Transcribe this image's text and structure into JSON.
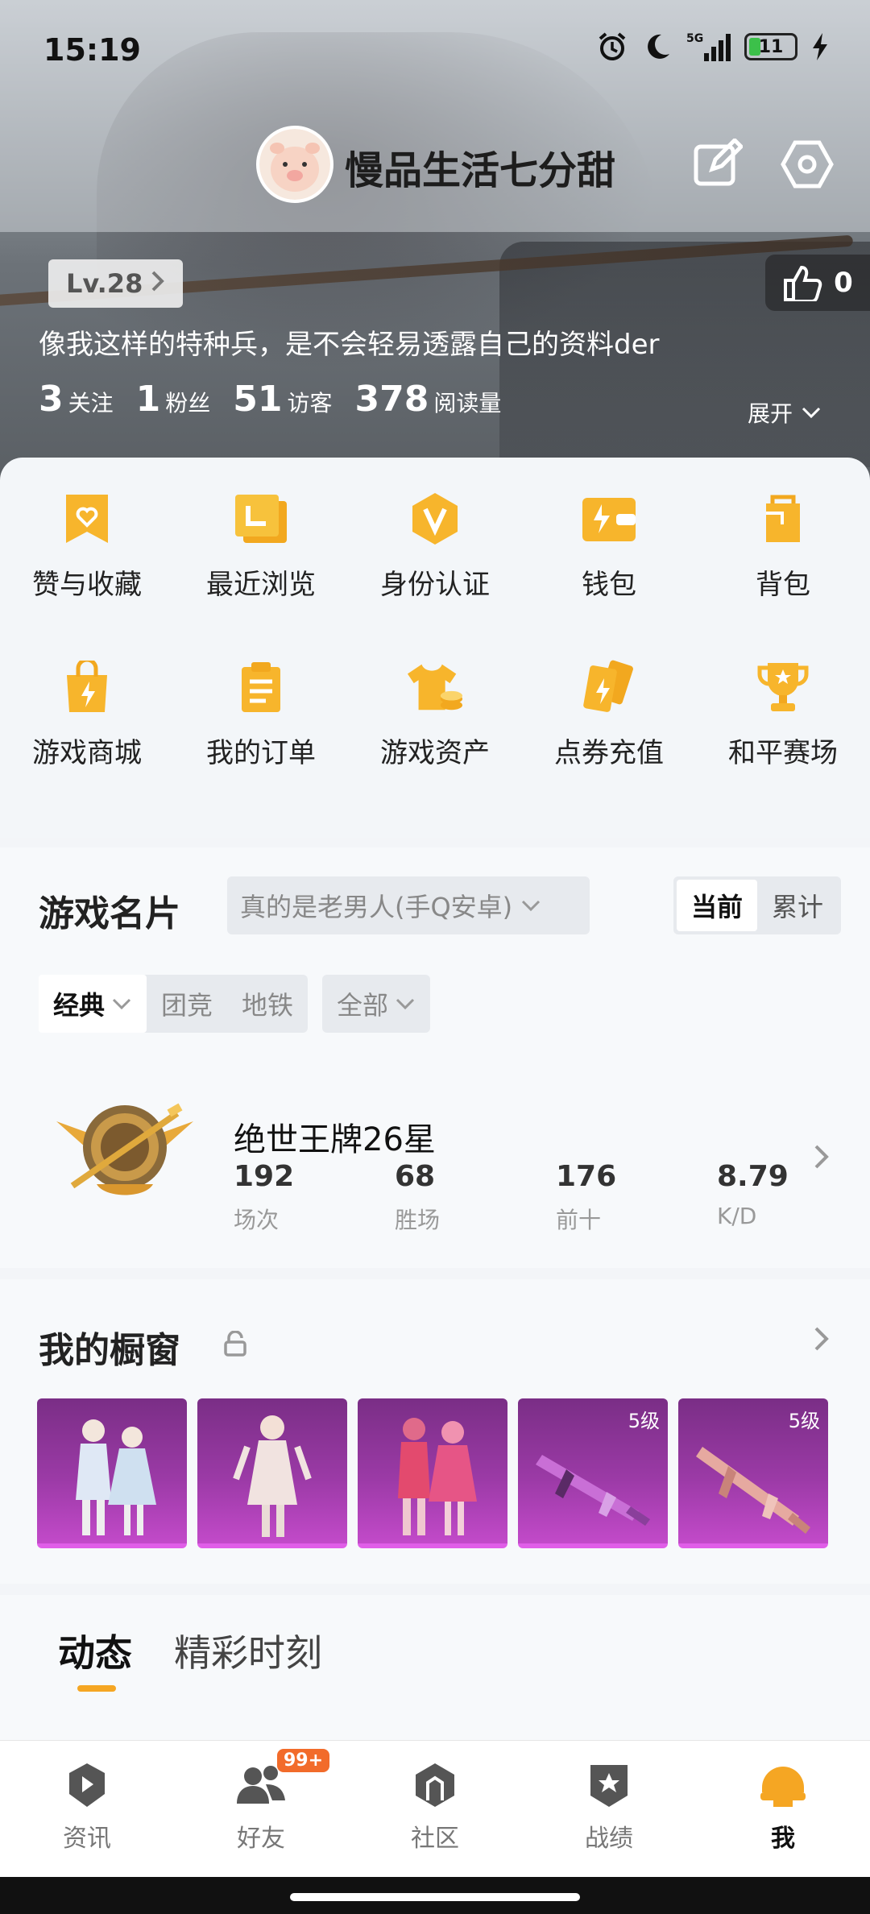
{
  "status_bar": {
    "time": "15:19",
    "network": "5G",
    "battery": "11"
  },
  "header": {
    "username": "慢品生活七分甜",
    "level": "Lv.28",
    "likes": "0",
    "bio": "像我这样的特种兵，是不会轻易透露自己的资料der",
    "counts": [
      {
        "num": "3",
        "label": "关注"
      },
      {
        "num": "1",
        "label": "粉丝"
      },
      {
        "num": "51",
        "label": "访客"
      },
      {
        "num": "378",
        "label": "阅读量"
      }
    ],
    "expand": "展开"
  },
  "quick_grid": [
    {
      "label": "赞与收藏",
      "icon": "heart-bookmark-icon"
    },
    {
      "label": "最近浏览",
      "icon": "history-icon"
    },
    {
      "label": "身份认证",
      "icon": "verify-v-icon"
    },
    {
      "label": "钱包",
      "icon": "wallet-icon"
    },
    {
      "label": "背包",
      "icon": "backpack-icon"
    },
    {
      "label": "游戏商城",
      "icon": "shopping-bag-icon"
    },
    {
      "label": "我的订单",
      "icon": "order-list-icon"
    },
    {
      "label": "游戏资产",
      "icon": "tshirt-coin-icon"
    },
    {
      "label": "点券充值",
      "icon": "coupon-cards-icon"
    },
    {
      "label": "和平赛场",
      "icon": "trophy-icon"
    }
  ],
  "game_card": {
    "title": "游戏名片",
    "account": "真的是老男人(手Q安卓)",
    "segments": [
      "当前",
      "累计"
    ],
    "modes": [
      "经典",
      "团竞",
      "地铁"
    ],
    "filter": "全部",
    "rank_name": "绝世王牌26星",
    "stats": [
      {
        "value": "192",
        "label": "场次"
      },
      {
        "value": "68",
        "label": "胜场"
      },
      {
        "value": "176",
        "label": "前十"
      },
      {
        "value": "8.79",
        "label": "K/D"
      }
    ]
  },
  "showcase": {
    "title": "我的橱窗",
    "items": [
      {
        "kind": "outfit-pair",
        "level": ""
      },
      {
        "kind": "outfit-single",
        "level": ""
      },
      {
        "kind": "outfit-pair-red",
        "level": ""
      },
      {
        "kind": "rifle-skin",
        "level": "5级"
      },
      {
        "kind": "rifle-skin",
        "level": "5级"
      }
    ]
  },
  "feed_tabs": [
    "动态",
    "精彩时刻"
  ],
  "bottom_nav": [
    {
      "label": "资讯",
      "icon": "news-play-icon"
    },
    {
      "label": "好友",
      "icon": "friends-icon",
      "badge": "99+"
    },
    {
      "label": "社区",
      "icon": "community-icon"
    },
    {
      "label": "战绩",
      "icon": "record-badge-icon"
    },
    {
      "label": "我",
      "icon": "me-helmet-icon"
    }
  ],
  "colors": {
    "accent": "#f5a623",
    "icon_yellow": "#f7b52c",
    "badge": "#f26b2a",
    "showcase_purple": "#9b3aa6"
  }
}
